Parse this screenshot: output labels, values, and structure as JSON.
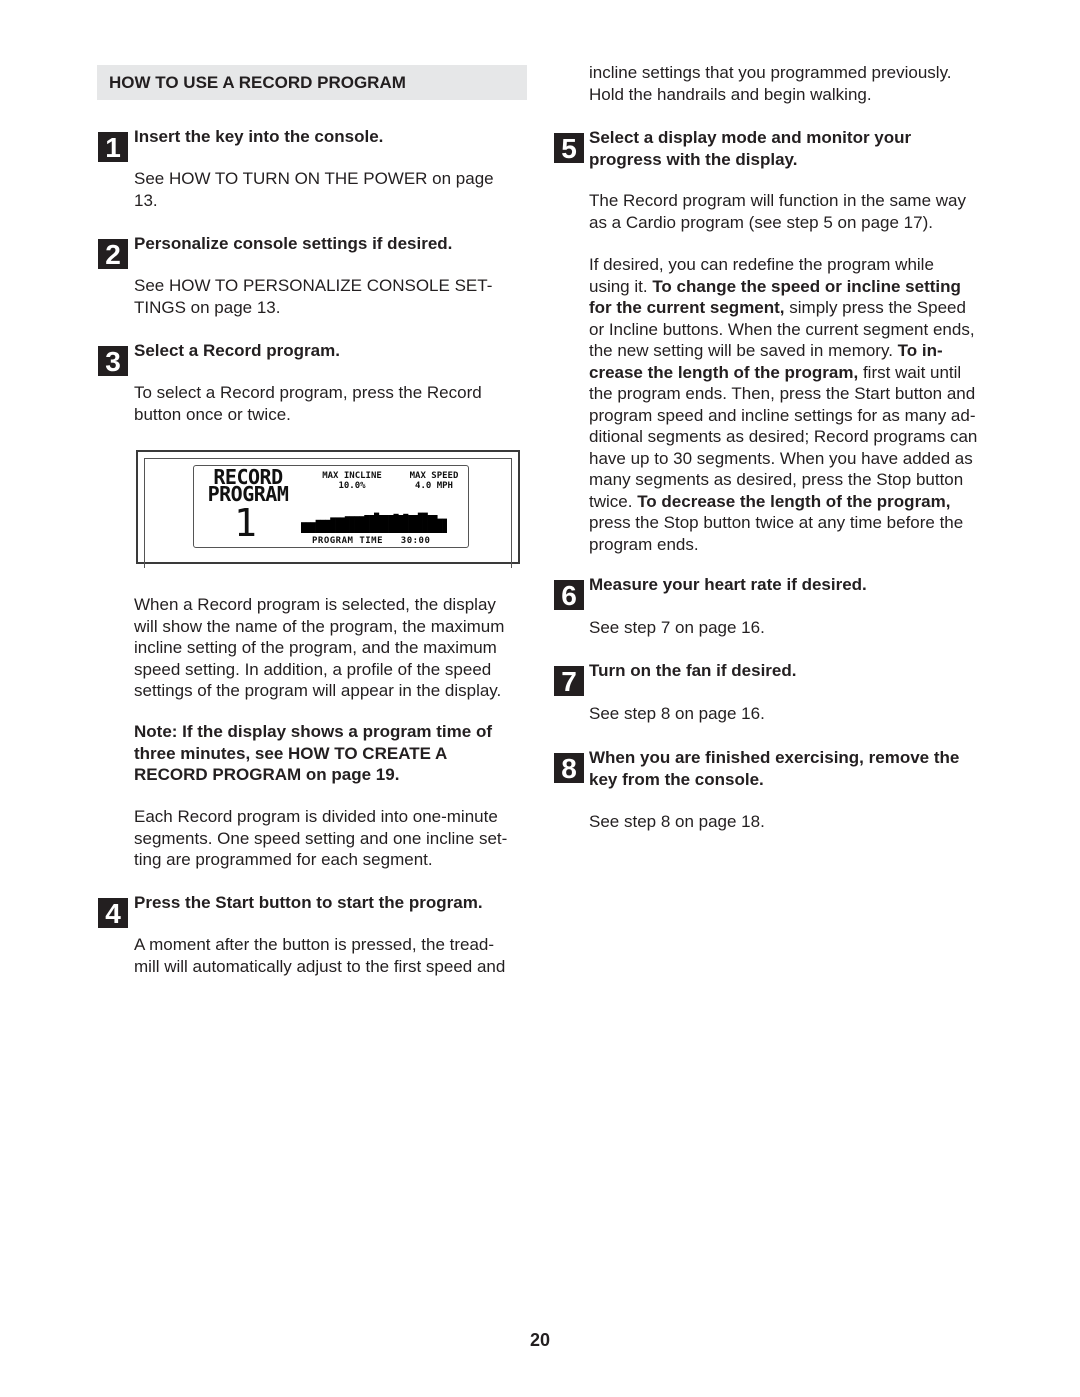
{
  "section": {
    "title": "HOW TO USE A RECORD PROGRAM"
  },
  "steps": [
    {
      "number": "1",
      "title": "Insert the key into the console.",
      "body": "See HOW TO TURN ON THE POWER on page 13."
    },
    {
      "number": "2",
      "title": "Personalize console settings if desired.",
      "body": "See HOW TO PERSONALIZE CONSOLE SET-TINGS on page 13."
    },
    {
      "number": "3",
      "title": "Select a Record program.",
      "body": "To select a Record program, press the Record button once or twice."
    },
    {
      "number": "4",
      "title": "Press the Start button to start the program.",
      "body": "A moment after the button is pressed, the tread-mill will automatically adjust to the first speed and"
    },
    {
      "number": "5",
      "title": "Select a display mode and monitor your progress with the display.",
      "body": "The Record program will function in the same way as a Cardio program (see step 5 on page 17)."
    },
    {
      "number": "6",
      "title": "Measure your heart rate if desired.",
      "body": "See step 7 on page 16."
    },
    {
      "number": "7",
      "title": "Turn on the fan if desired.",
      "body": "See step 8 on page 16."
    },
    {
      "number": "8",
      "title": "When you are finished exercising, remove the key from the console.",
      "body": "See step 8 on page 18."
    }
  ],
  "step1_lines": [
    "See HOW TO TURN ON THE POWER on page",
    "13."
  ],
  "step2_lines": [
    "See HOW TO PERSONALIZE CONSOLE SET-",
    "TINGS on page 13."
  ],
  "step3_lines": [
    "To select a Record program, press the Record",
    "button once or twice."
  ],
  "display_description_lines": [
    "When a Record program is selected, the display",
    "will show the name of the program, the maximum",
    "incline setting of the program, and the maximum",
    "speed setting. In addition, a profile of the speed",
    "settings of the program will appear in the display."
  ],
  "note_lines": [
    "Note: If the display shows a program time of",
    "three minutes, see HOW TO CREATE A",
    "RECORD PROGRAM on page 19."
  ],
  "segments_lines": [
    "Each Record program is divided into one-minute",
    "segments. One speed setting and one incline set-",
    "ting are programmed for each segment."
  ],
  "step4_lines": [
    "A moment after the button is pressed, the tread-",
    "mill will automatically adjust to the first speed and"
  ],
  "continued_lines": [
    "incline settings that you programmed previously.",
    "Hold the handrails and begin walking."
  ],
  "step5_title_lines": [
    "Select a display mode and monitor your",
    "progress with the display."
  ],
  "step5_lines": [
    "The Record program will function in the same way",
    "as a Cardio program (see step 5 on page 17)."
  ],
  "redefine_lines": [
    [
      {
        "t": "If desired, you can redefine the program while",
        "b": false
      }
    ],
    [
      {
        "t": "using it. ",
        "b": false
      },
      {
        "t": "To change the speed or incline setting",
        "b": true
      }
    ],
    [
      {
        "t": "for the current segment,",
        "b": true
      },
      {
        "t": " simply press the Speed",
        "b": false
      }
    ],
    [
      {
        "t": "or Incline buttons. When the current segment ends,",
        "b": false
      }
    ],
    [
      {
        "t": "the new setting will be saved in memory. ",
        "b": false
      },
      {
        "t": "To in-",
        "b": true
      }
    ],
    [
      {
        "t": "crease the length of the program,",
        "b": true
      },
      {
        "t": " first wait until",
        "b": false
      }
    ],
    [
      {
        "t": "the program ends. Then, press the Start button and",
        "b": false
      }
    ],
    [
      {
        "t": "program speed and incline settings for as many ad-",
        "b": false
      }
    ],
    [
      {
        "t": "ditional segments as desired; Record programs can",
        "b": false
      }
    ],
    [
      {
        "t": "have up to 30 segments. When you have added as",
        "b": false
      }
    ],
    [
      {
        "t": "many segments as desired, press the Stop button",
        "b": false
      }
    ],
    [
      {
        "t": "twice. ",
        "b": false
      },
      {
        "t": "To decrease the length of the program,",
        "b": true
      }
    ],
    [
      {
        "t": "press the Stop button twice at any time before the",
        "b": false
      }
    ],
    [
      {
        "t": "program ends.",
        "b": false
      }
    ]
  ],
  "step8_title_lines": [
    "When you are finished exercising, remove the",
    "key from the console."
  ],
  "display": {
    "title_line1": "RECORD",
    "title_line2": "PROGRAM",
    "program_number": "1",
    "max_incline_label": "MAX INCLINE",
    "max_incline_value": "10.0%",
    "max_speed_label": "MAX SPEED",
    "max_speed_value": "4.0 MPH",
    "program_time_label": "PROGRAM TIME",
    "program_time_value": "30:00",
    "speed_profile": [
      0.45,
      0.45,
      0.45,
      0.55,
      0.55,
      0.55,
      0.65,
      0.65,
      0.65,
      0.7,
      0.7,
      0.7,
      0.7,
      0.75,
      0.75,
      0.85,
      0.75,
      0.75,
      0.75,
      0.8,
      0.75,
      0.8,
      0.75,
      0.75,
      0.85,
      0.85,
      0.75,
      0.75,
      0.6,
      0.6
    ]
  },
  "page_number": "20"
}
